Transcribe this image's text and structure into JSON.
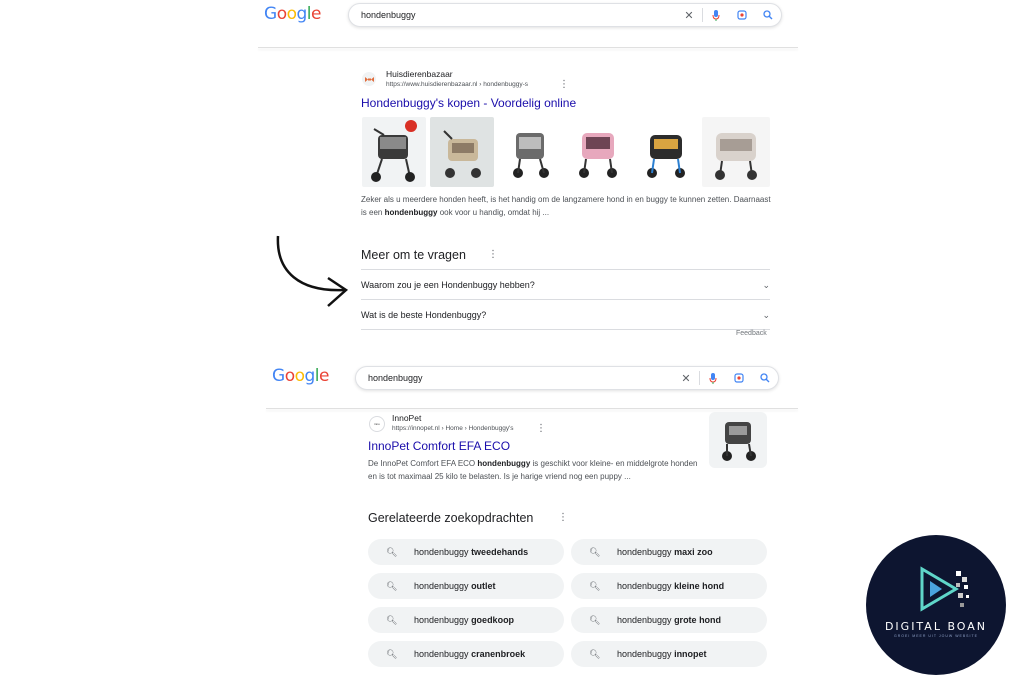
{
  "top": {
    "logo": [
      "G",
      "o",
      "o",
      "g",
      "l",
      "e"
    ],
    "query": "hondenbuggy",
    "result": {
      "site_name": "Huisdierenbazaar",
      "site_url": "https://www.huisdierenbazaar.nl › hondenbuggy-s",
      "title": "Hondenbuggy's kopen - Voordelig online",
      "snippet_parts": [
        "Zeker als u meerdere honden heeft, is het handig om de langzamere hond in en buggy te kunnen zetten. Daarnaast is een ",
        "hondenbuggy",
        " ook voor u handig, omdat hij ..."
      ]
    },
    "paa": {
      "title": "Meer om te vragen",
      "questions": [
        "Waarom zou je een Hondenbuggy hebben?",
        "Wat is de beste Hondenbuggy?"
      ],
      "feedback": "Feedback"
    }
  },
  "bottom": {
    "query": "hondenbuggy",
    "result": {
      "site_name": "InnoPet",
      "site_url": "https://innopet.nl › Home › Hondenbuggy's",
      "title": "InnoPet Comfort EFA ECO",
      "snippet_parts": [
        "De InnoPet Comfort EFA ECO ",
        "hondenbuggy",
        " is geschikt voor kleine- en middelgrote honden en is tot maximaal 25 kilo te belasten. Is je harige vriend nog een puppy ..."
      ]
    },
    "related": {
      "title": "Gerelateerde zoekopdrachten",
      "chips": [
        {
          "prefix": "hondenbuggy ",
          "bold": "tweedehands"
        },
        {
          "prefix": "hondenbuggy ",
          "bold": "maxi zoo"
        },
        {
          "prefix": "hondenbuggy ",
          "bold": "outlet"
        },
        {
          "prefix": "hondenbuggy ",
          "bold": "kleine hond"
        },
        {
          "prefix": "hondenbuggy ",
          "bold": "goedkoop"
        },
        {
          "prefix": "hondenbuggy ",
          "bold": "grote hond"
        },
        {
          "prefix": "hondenbuggy ",
          "bold": "cranenbroek"
        },
        {
          "prefix": "hondenbuggy ",
          "bold": "innopet"
        }
      ]
    }
  },
  "brand": {
    "name": "DIGITAL BOAN",
    "tagline": "GROEI MEER UIT JOUW WEBSITE"
  },
  "colors": {
    "link": "#1a0dab",
    "brand_bg": "#0d1530",
    "chip_bg": "#f1f3f4"
  }
}
